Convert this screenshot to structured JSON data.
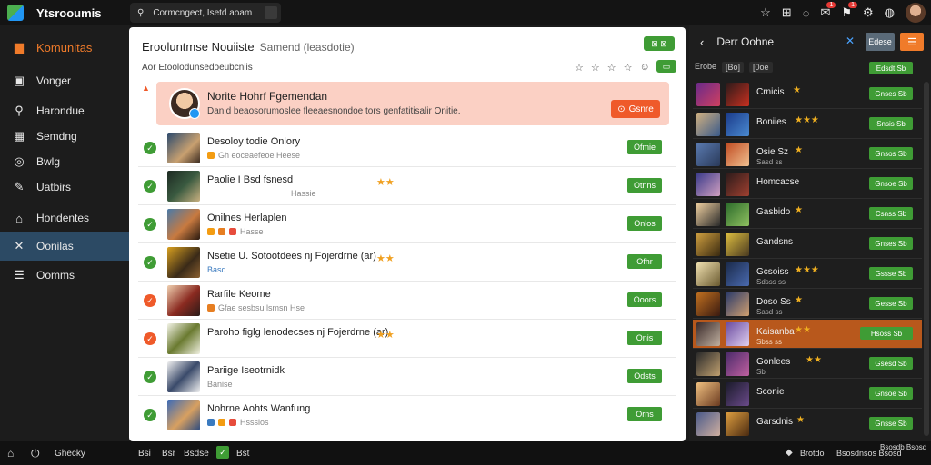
{
  "app": {
    "title": "Ytsrooumis"
  },
  "search": {
    "text": "Cormcngect, Isetd aoam",
    "icon": "search-icon"
  },
  "topbar": {
    "badge1": "1",
    "badge2": "1"
  },
  "sidebar": {
    "brand": "Komunitas",
    "items": [
      {
        "label": "Vonger",
        "icon": "bag-icon"
      },
      {
        "label": "Harondue",
        "icon": "route-icon"
      },
      {
        "label": "Semdng",
        "icon": "grid-icon"
      },
      {
        "label": "Bwlg",
        "icon": "globe-icon"
      },
      {
        "label": "Uatbirs",
        "icon": "pen-icon"
      },
      {
        "label": "Hondentes",
        "icon": "home-icon"
      },
      {
        "label": "Oonilas",
        "icon": "tools-icon"
      },
      {
        "label": "Oomms",
        "icon": "menu-icon"
      }
    ]
  },
  "main": {
    "title": "Erooluntmse Nouiiste",
    "subtitle": "Samend (leasdotie)",
    "header_button": "⊠ ⊠",
    "desc": "Aor Etoolodunsedoeubcniis",
    "header_icons": [
      "☆",
      "☆",
      "☆",
      "☆",
      "☺"
    ],
    "notice": {
      "title": "Norite Hohrf Fgemendan",
      "text": "Danid beaosorumoslee fleeaesnondoe tors genfatitisalir Onitie.",
      "button": "Gsnre"
    },
    "rows": [
      {
        "name": "Desoloy todie Onlory",
        "meta": "Gh eoceaefeoe Heese",
        "status": "ok",
        "stars": "",
        "action": "Ofmie"
      },
      {
        "name": "Paolie I Bsd fsnesd",
        "meta": "Hassie",
        "status": "ok",
        "stars": "★★",
        "action": "Otnns"
      },
      {
        "name": "Onilnes Herlaplen",
        "meta": "Hasse",
        "status": "ok",
        "stars": "",
        "action": "Onlos"
      },
      {
        "name": "Nsetie U. Sotootdees nj Fojerdrne (ar)",
        "meta": "Basd",
        "status": "ok",
        "stars": "★★",
        "action": "Ofhr"
      },
      {
        "name": "Rarfile Keome",
        "meta": "Gfae sesbsu lsmsn Hse",
        "status": "warn",
        "stars": "",
        "action": "Ooors"
      },
      {
        "name": "Paroho figlg lenodecses nj Fojerdrne (ar)",
        "meta": "",
        "status": "warn",
        "stars": "★★",
        "action": "Onis"
      },
      {
        "name": "Pariige Iseotrnidk",
        "meta": "Banise",
        "status": "ok",
        "stars": "",
        "action": "Odsts"
      },
      {
        "name": "Nohrne Aohts Wanfung",
        "meta": "Hsssios",
        "status": "ok",
        "stars": "",
        "action": "Orns"
      }
    ]
  },
  "right": {
    "title": "Derr Oohne",
    "btn1": "Edese",
    "btn2": "☰",
    "filters": [
      "Erobe",
      "[Bo]",
      "[0oe"
    ],
    "rows": [
      {
        "name": "",
        "sub": "",
        "stars": "",
        "action": "Edsdt Sb",
        "hl": false
      },
      {
        "name": "Crnicis",
        "sub": "",
        "stars": "★",
        "action": "Gnses Sb",
        "hl": false
      },
      {
        "name": "Boniies",
        "sub": "",
        "stars": "★★★",
        "action": "Snsis Sb",
        "hl": false
      },
      {
        "name": "Osie Sz",
        "sub": "Sasd ss",
        "stars": "★",
        "action": "Gnsos Sb",
        "hl": false
      },
      {
        "name": "Homcacse",
        "sub": "",
        "stars": "",
        "action": "Gnsoe Sb",
        "hl": false
      },
      {
        "name": "Gasbido",
        "sub": "",
        "stars": "★",
        "action": "Csnss Sb",
        "hl": false
      },
      {
        "name": "Gandsns",
        "sub": "",
        "stars": "",
        "action": "Gnses Sb",
        "hl": false
      },
      {
        "name": "Gcsoiss",
        "sub": "Sdsss ss",
        "stars": "★★★",
        "action": "Gssse Sb",
        "hl": false
      },
      {
        "name": "Doso Ss",
        "sub": "Sasd ss",
        "stars": "★",
        "action": "Gesse Sb",
        "hl": false
      },
      {
        "name": "Kaisanba",
        "sub": "Sbss ss",
        "stars": "★★",
        "action": "Hsoss Sb",
        "hl": true
      },
      {
        "name": "Gonlees",
        "sub": "Sb",
        "stars": "★★",
        "action": "Gsesd Sb",
        "hl": false
      },
      {
        "name": "Sconie",
        "sub": "",
        "stars": "",
        "action": "Gnsoe Sb",
        "hl": false
      },
      {
        "name": "Garsdnis",
        "sub": "",
        "stars": "★",
        "action": "Gnsse Sb",
        "hl": false
      }
    ]
  },
  "bottom": {
    "label": "Ghecky",
    "items": [
      "Bsi",
      "Bsr",
      "Bsdse",
      "Bst"
    ],
    "right_text1": "Brotdo",
    "right_text2": "Bsosdnsos Bsosd",
    "right_text3": "Bsosdb Bsosd"
  },
  "colors": {
    "accent": "#f07b2a",
    "green": "#3f9c35",
    "active": "#2c4a64",
    "highlight": "#b8581c"
  }
}
